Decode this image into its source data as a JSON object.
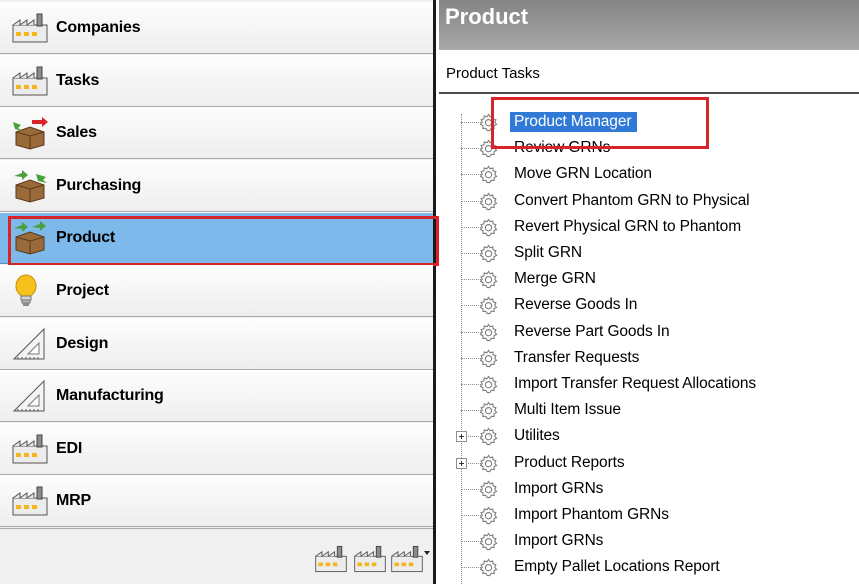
{
  "nav": {
    "items": [
      {
        "label": "Companies",
        "icon": "factory-icon"
      },
      {
        "label": "Tasks",
        "icon": "factory-icon"
      },
      {
        "label": "Sales",
        "icon": "box-out-icon"
      },
      {
        "label": "Purchasing",
        "icon": "box-in-icon"
      },
      {
        "label": "Product",
        "icon": "box-icon"
      },
      {
        "label": "Project",
        "icon": "lightbulb-icon"
      },
      {
        "label": "Design",
        "icon": "set-square-icon"
      },
      {
        "label": "Manufacturing",
        "icon": "set-square-icon"
      },
      {
        "label": "EDI",
        "icon": "factory-icon"
      },
      {
        "label": "MRP",
        "icon": "factory-icon"
      }
    ],
    "active_index": 4
  },
  "panel": {
    "title": "Product",
    "tasks_label": "Product Tasks"
  },
  "tree": {
    "items": [
      {
        "label": "Product Manager",
        "expandable": false,
        "selected": true
      },
      {
        "label": "Review GRNs",
        "expandable": false
      },
      {
        "label": "Move GRN Location",
        "expandable": false
      },
      {
        "label": "Convert Phantom GRN to Physical",
        "expandable": false
      },
      {
        "label": "Revert Physical GRN to Phantom",
        "expandable": false
      },
      {
        "label": "Split GRN",
        "expandable": false
      },
      {
        "label": "Merge GRN",
        "expandable": false
      },
      {
        "label": "Reverse Goods In",
        "expandable": false
      },
      {
        "label": "Reverse Part Goods In",
        "expandable": false
      },
      {
        "label": "Transfer Requests",
        "expandable": false
      },
      {
        "label": "Import Transfer Request Allocations",
        "expandable": false
      },
      {
        "label": "Multi Item Issue",
        "expandable": false
      },
      {
        "label": "Utilites",
        "expandable": true
      },
      {
        "label": "Product Reports",
        "expandable": true
      },
      {
        "label": "Import GRNs",
        "expandable": false
      },
      {
        "label": "Import Phantom GRNs",
        "expandable": false
      },
      {
        "label": "Import GRNs",
        "expandable": false
      },
      {
        "label": "Empty Pallet Locations Report",
        "expandable": false
      }
    ]
  },
  "colors": {
    "active_nav": "#7db9eb",
    "highlight": "#d8232a",
    "selection": "#3079d6"
  }
}
